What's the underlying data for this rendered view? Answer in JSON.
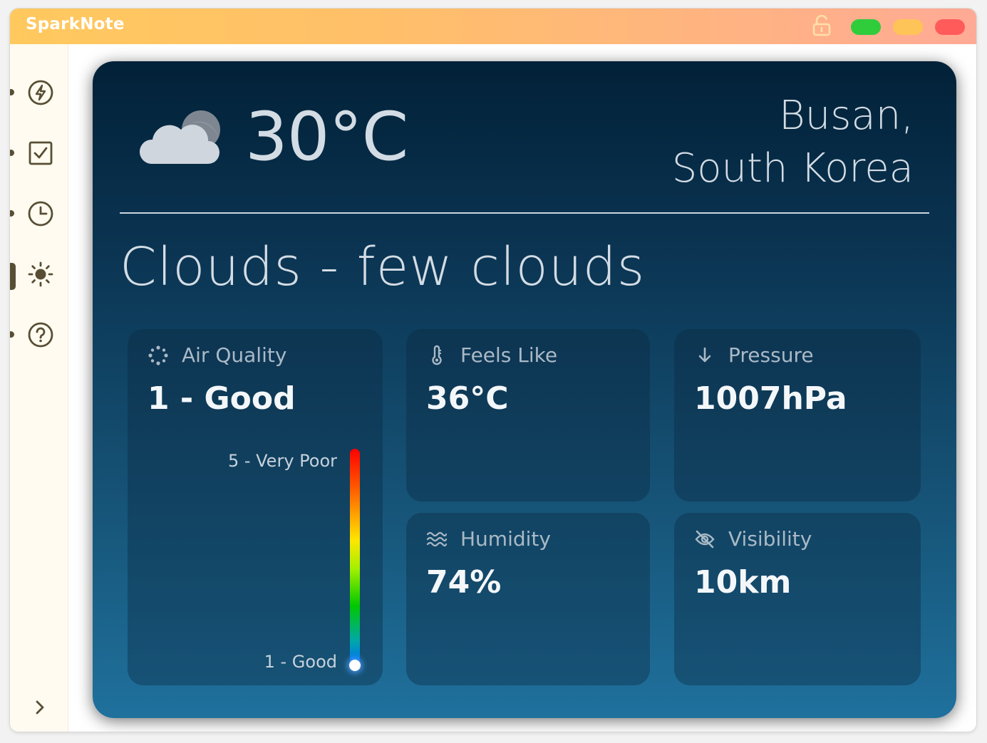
{
  "app": {
    "title": "SparkNote",
    "accent_gradient": [
      "#ffc95e",
      "#ffaa96"
    ],
    "window_buttons": [
      "#2fcc3c",
      "#ffc457",
      "#ff5b5b"
    ]
  },
  "sidebar": {
    "items": [
      {
        "icon": "lightning-icon",
        "active": false
      },
      {
        "icon": "checkbox-icon",
        "active": false
      },
      {
        "icon": "clock-icon",
        "active": false
      },
      {
        "icon": "sun-icon",
        "active": true
      },
      {
        "icon": "help-icon",
        "active": false
      }
    ],
    "expand_icon": "chevron-right-icon"
  },
  "weather": {
    "temperature": "30°C",
    "location_line1": "Busan,",
    "location_line2": "South Korea",
    "condition": "Clouds - few clouds",
    "icon": "cloud-moon-icon",
    "tiles": {
      "air_quality": {
        "label": "Air Quality",
        "value": "1 - Good",
        "scale_top": "5 - Very Poor",
        "scale_bottom": "1 - Good",
        "level": 1,
        "max_level": 5
      },
      "feels_like": {
        "label": "Feels Like",
        "value": "36°C"
      },
      "pressure": {
        "label": "Pressure",
        "value": "1007hPa"
      },
      "humidity": {
        "label": "Humidity",
        "value": "74%"
      },
      "visibility": {
        "label": "Visibility",
        "value": "10km"
      }
    }
  }
}
